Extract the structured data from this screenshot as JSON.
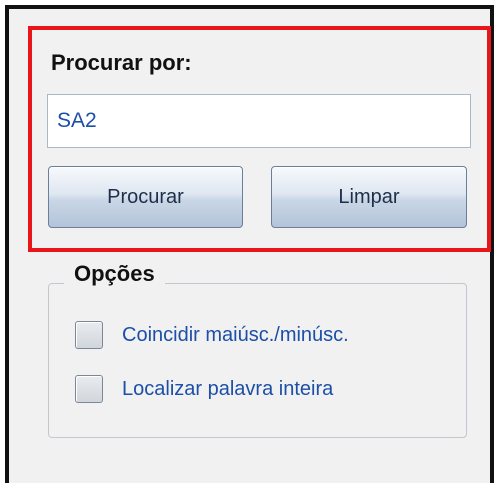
{
  "search": {
    "label": "Procurar por:",
    "value": "SA2",
    "search_button": "Procurar",
    "clear_button": "Limpar"
  },
  "options": {
    "title": "Opções",
    "items": [
      {
        "label": "Coincidir maiúsc./minúsc.",
        "checked": false
      },
      {
        "label": "Localizar palavra inteira",
        "checked": false
      }
    ]
  },
  "colors": {
    "highlight": "#e8161b",
    "option_text": "#1c4fa7",
    "input_text": "#1c4fa7",
    "panel_background": "#f1f1f1"
  },
  "icons": [
    "checkbox-unchecked-icon",
    "checkbox-unchecked-icon"
  ]
}
